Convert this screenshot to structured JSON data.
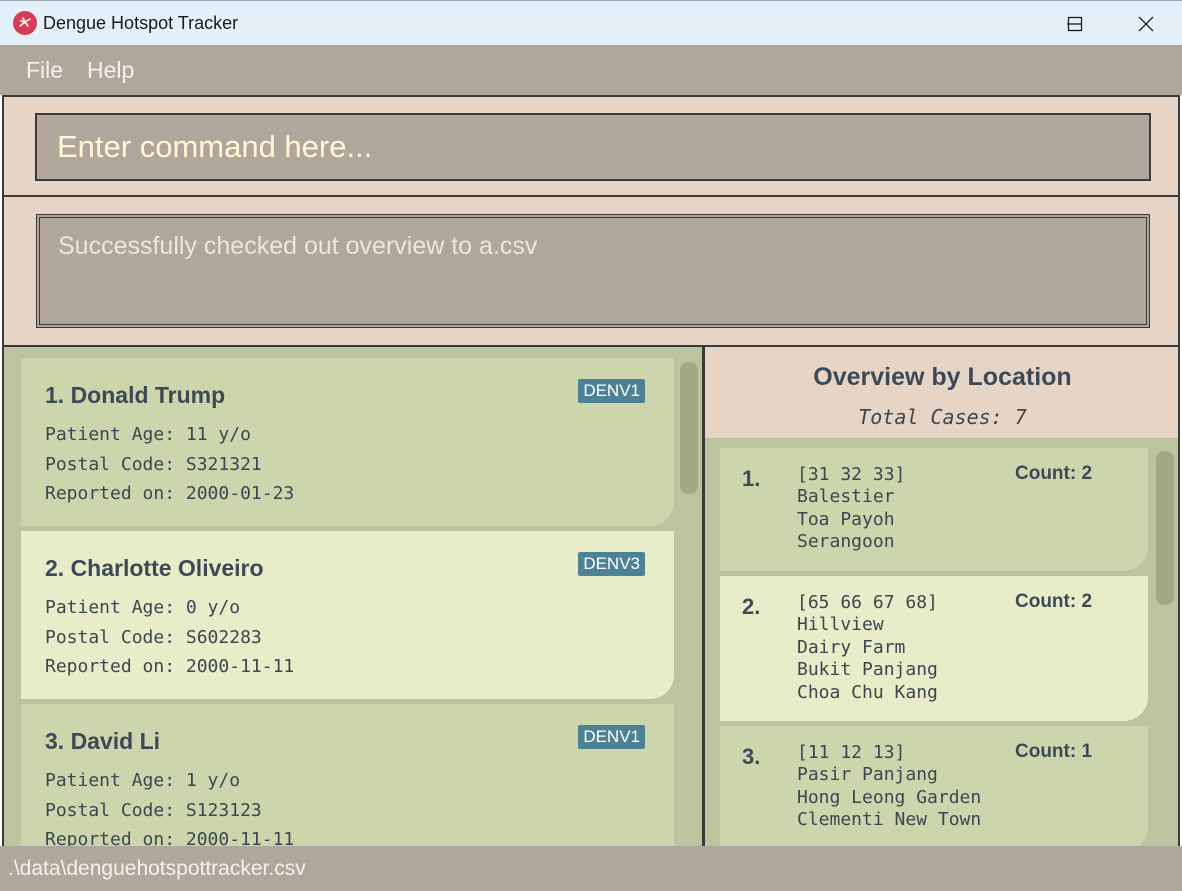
{
  "window": {
    "title": "Dengue Hotspot Tracker",
    "icon": "mosquito-app-icon"
  },
  "menu": {
    "file": "File",
    "help": "Help"
  },
  "command": {
    "placeholder": "Enter command here..."
  },
  "result": {
    "message": "Successfully checked out overview to a.csv"
  },
  "cases": [
    {
      "name": "1. Donald Trump",
      "variant": "DENV1",
      "age": "Patient Age: 11 y/o",
      "postal": "Postal Code: S321321",
      "date": "Reported on: 2000-01-23"
    },
    {
      "name": "2. Charlotte Oliveiro",
      "variant": "DENV3",
      "age": "Patient Age: 0 y/o",
      "postal": "Postal Code: S602283",
      "date": "Reported on: 2000-11-11"
    },
    {
      "name": "3. David Li",
      "variant": "DENV1",
      "age": "Patient Age: 1 y/o",
      "postal": "Postal Code: S123123",
      "date": "Reported on: 2000-11-11"
    }
  ],
  "overview": {
    "title": "Overview by Location",
    "total": "Total Cases: 7",
    "items": [
      {
        "index": "1.",
        "count": "Count: 2",
        "lines": [
          "[31 32 33]",
          "Balestier",
          "Toa Payoh",
          "Serangoon"
        ]
      },
      {
        "index": "2.",
        "count": "Count: 2",
        "lines": [
          "[65 66 67 68]",
          "Hillview",
          "Dairy Farm",
          "Bukit Panjang",
          "Choa Chu Kang"
        ]
      },
      {
        "index": "3.",
        "count": "Count: 1",
        "lines": [
          "[11 12 13]",
          "Pasir Panjang",
          "Hong Leong Garden",
          "Clementi New Town"
        ]
      }
    ]
  },
  "status": {
    "path": ".\\data\\denguehotspottracker.csv"
  },
  "colors": {
    "titlebar": "#e4eff7",
    "menubar": "#b1a69b",
    "panel": "#e6d5c6",
    "card_odd": "#cdd5ad",
    "card_even": "#e8ecc9",
    "badge": "#4e8193",
    "text": "#3d4a55"
  }
}
